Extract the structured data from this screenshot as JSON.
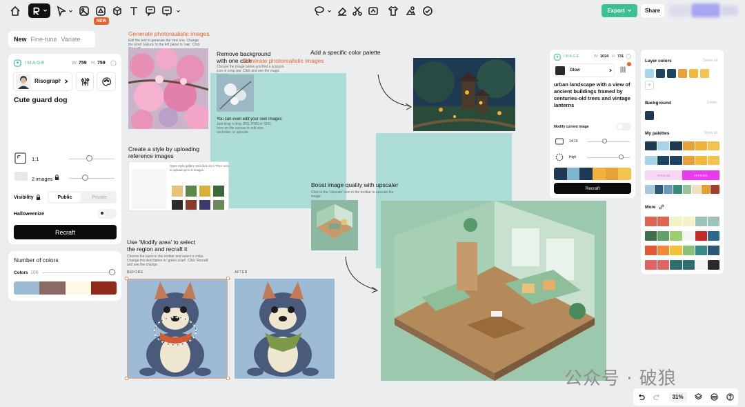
{
  "toolbar": {
    "new_badge": "NEW",
    "export_label": "Export",
    "share_label": "Share"
  },
  "left_panel": {
    "tabs": [
      "New",
      "Fine-tune",
      "Variate"
    ],
    "image_label": "IMAGE",
    "w_label": "W:",
    "w_value": "759",
    "h_label": "H:",
    "h_value": "759",
    "style_name": "Risograph",
    "prompt": "Cute guard dog",
    "ratio": "1:1",
    "images_count": "2 images",
    "visibility_label": "Visibility",
    "visibility_options": [
      "Public",
      "Private"
    ],
    "halloweenize_label": "Halloweenize",
    "recraft_label": "Recraft",
    "number_of_colors_title": "Number of colors",
    "colors_label": "Colors",
    "colors_value": "108",
    "palette": [
      "#9ebbd6",
      "#8a6a63",
      "#fdf9e2",
      "#8f2a1d"
    ]
  },
  "canvas": {
    "generate_title": "Generate photorealistic images",
    "generate_desc": "Edit the text to generate the new one. Change the word 'sakura' to the left panel to 'oak'. Click 'Recraft'.",
    "remove_bg_title_1": "Remove background",
    "remove_bg_title_2": "with one click",
    "remove_bg_overlay": "Generate photorealistic images",
    "remove_bg_desc": "Choose the image below and find a scissors icon in a top bar. Click and see the magic happen.",
    "edit_title": "You can even edit your own images",
    "edit_desc": "Just drag n drop JPG, PNG or SVG here on the canvas to edit size, vectorize, or upscale.",
    "palette_title": "Add a specific color palette",
    "style_title_1": "Create a style by uploading",
    "style_title_2": "reference images",
    "style_desc": "Open style gallery and click on a 'Plus' icon to upload up to 5 images.",
    "upscale_title": "Boost image quality with upscaler",
    "upscale_desc": "Click to the 'Upscale' icon in the toolbar to upscale the image.",
    "modify_title_1": "Use 'Modify area' to select",
    "modify_title_2": "the region  and recraft it",
    "modify_desc": "Choose the lasso in the toolbar and select a collar. Change the description to 'green scarf'. Click 'Recraft' and see the change.",
    "before_label": "BEFORE",
    "after_label": "AFTER"
  },
  "right_panel": {
    "image_label": "IMAGE",
    "w_label": "W:",
    "w_value": "1024",
    "h_label": "H:",
    "h_value": "731",
    "style_name": "Glow",
    "prompt": "urban landscape with a view of ancient buildings framed by centuries-old trees and vintage lanterns",
    "modify_label": "Modify current image",
    "ratio": "14:10",
    "quality": "High",
    "recraft_label": "Recraft",
    "palette": [
      "#1e3a52",
      "#7fb5cf",
      "#1e3a52",
      "#f0b23a",
      "#e9a23a",
      "#f3c24f"
    ]
  },
  "colors_panel": {
    "layer_colors_title": "Layer colors",
    "layer_colors_action": "Delete all",
    "layer_colors": [
      "#a8d4ea",
      "#1e4462",
      "#1e4462",
      "#e6a13a",
      "#f0ba3e",
      "#f3c24f"
    ],
    "background_title": "Background",
    "background_action": "Delete",
    "background_color": "#1e3a52",
    "my_palettes_title": "My palettes",
    "my_palettes_action": "Show all",
    "palette_tag_a": "#F53A3B",
    "palette_tag_b": "#EF3AEE",
    "more_title": "More",
    "palettes": [
      [
        "#1e3a52",
        "#a8d4ea",
        "#1e3a52",
        "#e6a13a",
        "#f0b23a",
        "#f3c24f"
      ],
      [
        "#a8d4ea",
        "#1e4462",
        "#1e4462",
        "#e6a13a",
        "#f0ba3e",
        "#f3c24f"
      ],
      [
        "#f6d6f2",
        "#f6d6f2",
        "#f6d6f2",
        "#e93af0",
        "#e93af0",
        "#e93af0"
      ],
      [
        "#a8c8e0",
        "#2c5a7a",
        "#6a9ab8",
        "#3a8a7a",
        "#9ac0a0",
        "#f0e0c0",
        "#e8a030",
        "#a0402a"
      ]
    ],
    "more_palettes": [
      [
        "#e06454",
        "#e06454",
        "#f3f2c8",
        "#f3f2c8",
        "#9cc4bc",
        "#9cc4bc"
      ],
      [
        "#3e6e4a",
        "#62a06a",
        "#9ad070",
        "#f4f4f4",
        "#c42a2a",
        "#2a6a8a"
      ],
      [
        "#e05a3a",
        "#f08a3a",
        "#f4c03a",
        "#8ac07a",
        "#3a8a8a",
        "#2a5a7a"
      ],
      [
        "#e06464",
        "#e06464",
        "#2e7070",
        "#2e7070",
        "#f4f4f4",
        "#2a2a2a"
      ]
    ]
  },
  "bottom_bar": {
    "zoom": "31%"
  },
  "watermark": "公众号 · 破狼"
}
